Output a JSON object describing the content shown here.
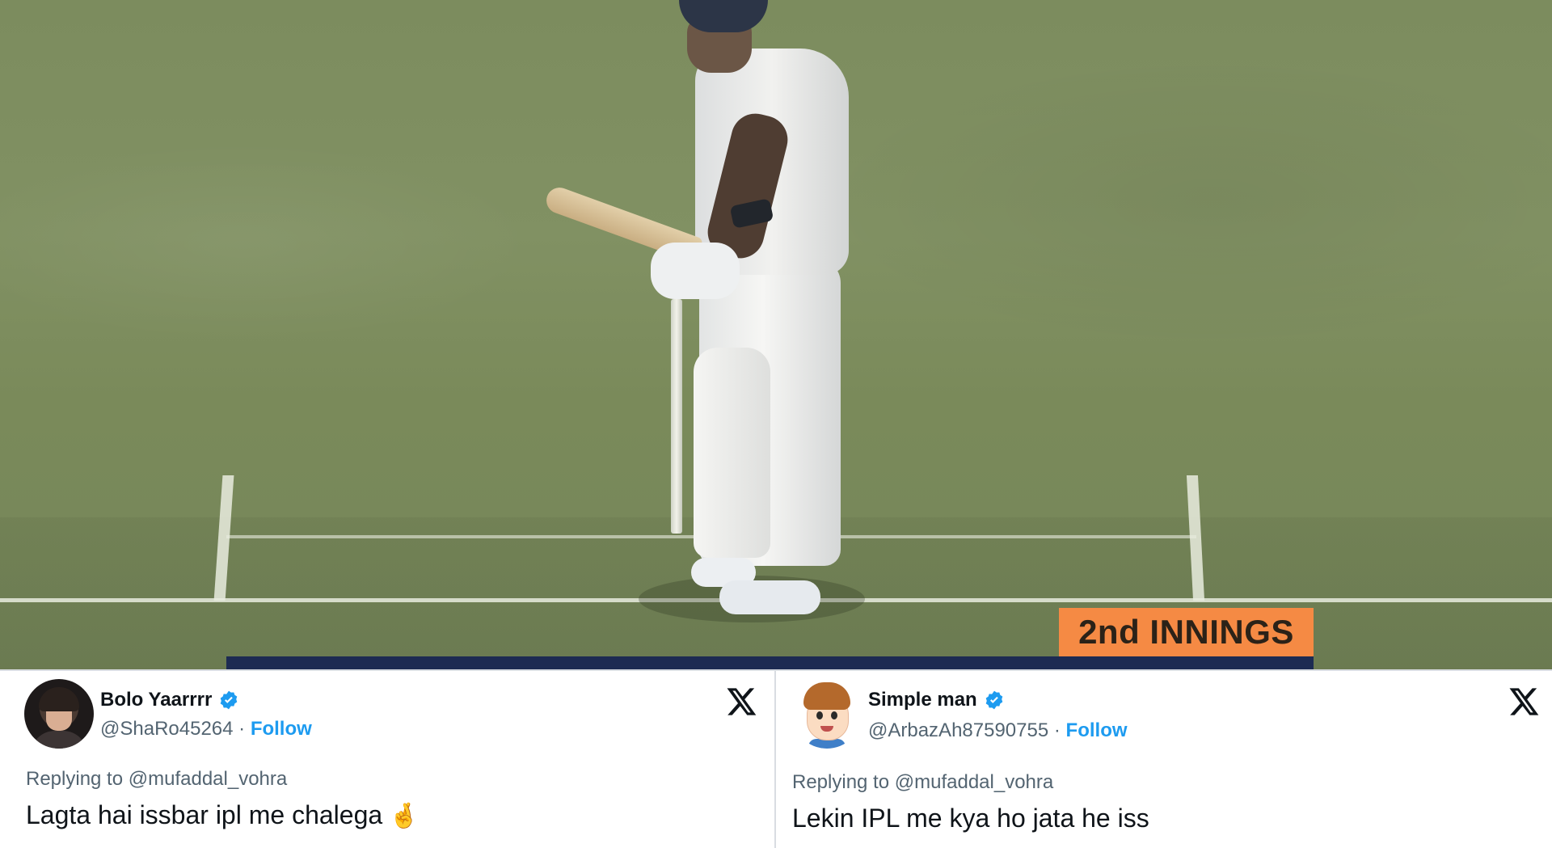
{
  "broadcast": {
    "innings_label": "2nd INNINGS",
    "colors": {
      "badge": "#f58a44",
      "strip": "#1d2b52",
      "grass": "#7f8f60"
    }
  },
  "tweets": [
    {
      "display_name": "Bolo Yaarrrr",
      "handle": "@ShaRo45264",
      "separator": " · ",
      "follow_label": "Follow",
      "replying_prefix": "Replying to",
      "replying_to": "@mufaddal_vohra",
      "text": "Lagta hai issbar ipl me chalega",
      "emoji": "🤞",
      "avatar": "photo-avatar",
      "verified_icon": "verified-badge-icon",
      "platform_icon": "x-logo-icon"
    },
    {
      "display_name": "Simple man",
      "handle": "@ArbazAh87590755",
      "separator": " · ",
      "follow_label": "Follow",
      "replying_prefix": "Replying to",
      "replying_to": "@mufaddal_vohra",
      "text": "Lekin IPL me kya ho jata he iss",
      "avatar": "cartoon-boy-avatar",
      "verified_icon": "verified-badge-icon",
      "platform_icon": "x-logo-icon"
    }
  ],
  "colors": {
    "verified": "#1d9bf0",
    "link": "#1d9bf0",
    "muted": "#536471",
    "text": "#0f1419"
  }
}
